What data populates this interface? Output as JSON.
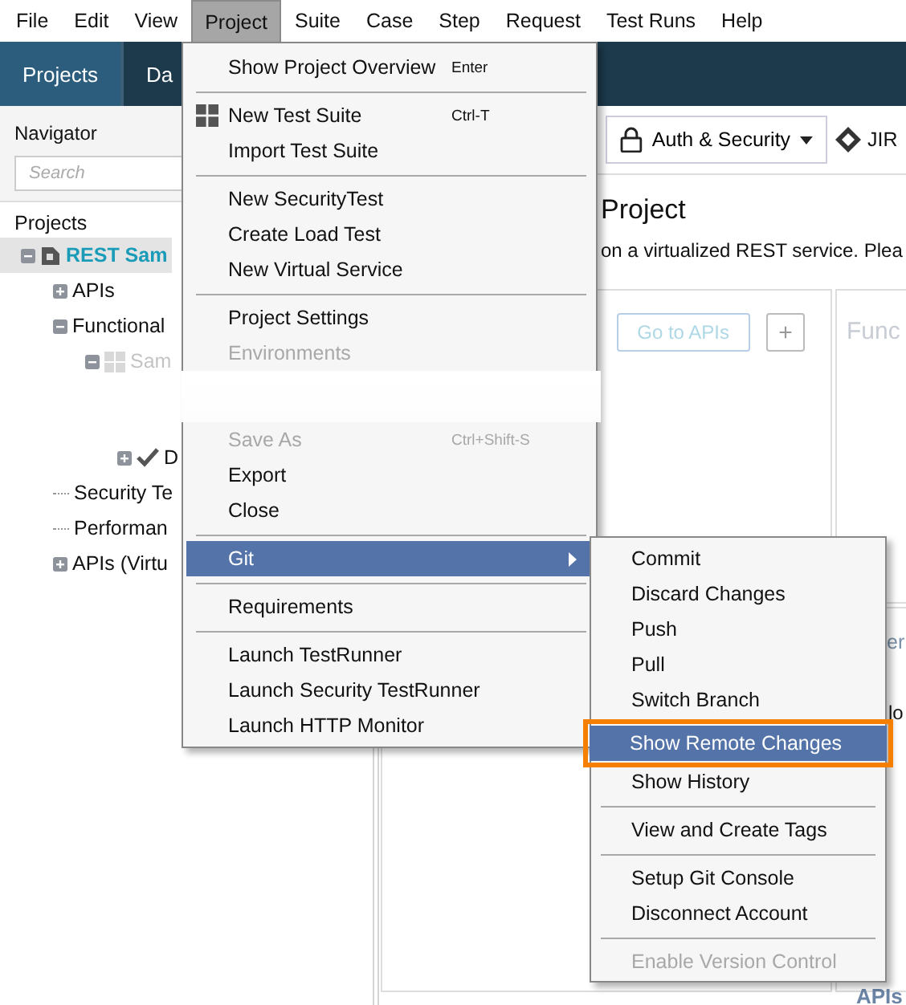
{
  "menubar": [
    {
      "label": "File",
      "selected": false
    },
    {
      "label": "Edit",
      "selected": false
    },
    {
      "label": "View",
      "selected": false
    },
    {
      "label": "Project",
      "selected": true
    },
    {
      "label": "Suite",
      "selected": false
    },
    {
      "label": "Case",
      "selected": false
    },
    {
      "label": "Step",
      "selected": false
    },
    {
      "label": "Request",
      "selected": false
    },
    {
      "label": "Test Runs",
      "selected": false
    },
    {
      "label": "Help",
      "selected": false
    }
  ],
  "tabs": [
    {
      "label": "Projects",
      "selected": true
    },
    {
      "label": "Da",
      "selected": false
    }
  ],
  "navigator": {
    "title": "Navigator",
    "search": {
      "placeholder": "Search"
    },
    "heading": "Projects",
    "tree": [
      {
        "label": "REST Sam",
        "kind": "project",
        "expanded": true,
        "selected": true,
        "children": [
          {
            "label": "APIs",
            "expanded": false,
            "selected": false
          },
          {
            "label": "Functional",
            "expanded": true,
            "selected": false,
            "children": [
              {
                "label": "Sam",
                "kind": "suite",
                "expanded": true,
                "selected": false,
                "children": [
                  {
                    "label": "D",
                    "kind": "case",
                    "expanded": false,
                    "selected": false
                  }
                ]
              }
            ]
          },
          {
            "label": "Security Te",
            "selected": false
          },
          {
            "label": "Performan",
            "selected": false
          },
          {
            "label": "APIs (Virtu",
            "expanded": false,
            "selected": false
          }
        ]
      }
    ]
  },
  "toolbar": {
    "auth_button": "Auth & Security",
    "jira_label": "JIR"
  },
  "content": {
    "title": "Project",
    "description": "on a virtualized REST service. Plea",
    "apis_button": "Go to APIs",
    "add_button": "+",
    "func_heading": "Func",
    "perf_heading": "er",
    "perf_text": "lo",
    "apis_heading": "APIs"
  },
  "project_menu": [
    {
      "kind": "item",
      "label": "Show Project Overview",
      "shortcut": "Enter",
      "disabled": false,
      "has_icon": false,
      "submenu": false,
      "selected": false
    },
    {
      "kind": "separator"
    },
    {
      "kind": "item",
      "label": "New Test Suite",
      "shortcut": "Ctrl-T",
      "disabled": false,
      "has_icon": true,
      "submenu": false,
      "selected": false
    },
    {
      "kind": "item",
      "label": "Import Test Suite",
      "disabled": false,
      "has_icon": false,
      "submenu": false,
      "selected": false
    },
    {
      "kind": "separator"
    },
    {
      "kind": "item",
      "label": "New SecurityTest",
      "disabled": false,
      "has_icon": false,
      "submenu": false,
      "selected": false
    },
    {
      "kind": "item",
      "label": "Create Load Test",
      "disabled": false,
      "has_icon": false,
      "submenu": false,
      "selected": false
    },
    {
      "kind": "item",
      "label": "New Virtual Service",
      "disabled": false,
      "has_icon": false,
      "submenu": false,
      "selected": false
    },
    {
      "kind": "separator"
    },
    {
      "kind": "item",
      "label": "Project Settings",
      "disabled": false,
      "has_icon": false,
      "submenu": false,
      "selected": false
    },
    {
      "kind": "item",
      "label": "Environments",
      "disabled": true,
      "has_icon": false,
      "submenu": false,
      "selected": false
    },
    {
      "kind": "fade"
    },
    {
      "kind": "item",
      "label": "Save As",
      "shortcut": "Ctrl+Shift-S",
      "disabled": true,
      "has_icon": false,
      "submenu": false,
      "selected": false
    },
    {
      "kind": "item",
      "label": "Export",
      "disabled": false,
      "has_icon": false,
      "submenu": false,
      "selected": false
    },
    {
      "kind": "item",
      "label": "Close",
      "disabled": false,
      "has_icon": false,
      "submenu": false,
      "selected": false
    },
    {
      "kind": "separator"
    },
    {
      "kind": "item",
      "label": "Git",
      "disabled": false,
      "has_icon": false,
      "submenu": true,
      "selected": true
    },
    {
      "kind": "separator"
    },
    {
      "kind": "item",
      "label": "Requirements",
      "disabled": false,
      "has_icon": false,
      "submenu": false,
      "selected": false
    },
    {
      "kind": "separator"
    },
    {
      "kind": "item",
      "label": "Launch TestRunner",
      "disabled": false,
      "has_icon": false,
      "submenu": false,
      "selected": false
    },
    {
      "kind": "item",
      "label": "Launch Security TestRunner",
      "disabled": false,
      "has_icon": false,
      "submenu": false,
      "selected": false
    },
    {
      "kind": "item",
      "label": "Launch HTTP Monitor",
      "disabled": false,
      "has_icon": false,
      "submenu": false,
      "selected": false
    }
  ],
  "git_menu": [
    {
      "kind": "item",
      "label": "Commit",
      "disabled": false,
      "selected": false
    },
    {
      "kind": "item",
      "label": "Discard Changes",
      "disabled": false,
      "selected": false
    },
    {
      "kind": "item",
      "label": "Push",
      "disabled": false,
      "selected": false
    },
    {
      "kind": "item",
      "label": "Pull",
      "disabled": false,
      "selected": false
    },
    {
      "kind": "item",
      "label": "Switch Branch",
      "disabled": false,
      "selected": false
    },
    {
      "kind": "item",
      "label": "Show Remote Changes",
      "disabled": false,
      "selected": true
    },
    {
      "kind": "item",
      "label": "Show History",
      "disabled": false,
      "selected": false
    },
    {
      "kind": "separator"
    },
    {
      "kind": "item",
      "label": "View and Create Tags",
      "disabled": false,
      "selected": false
    },
    {
      "kind": "separator"
    },
    {
      "kind": "item",
      "label": "Setup Git Console",
      "disabled": false,
      "selected": false
    },
    {
      "kind": "item",
      "label": "Disconnect Account",
      "disabled": false,
      "selected": false
    },
    {
      "kind": "separator"
    },
    {
      "kind": "item",
      "label": "Enable Version Control",
      "disabled": true,
      "selected": false
    }
  ]
}
